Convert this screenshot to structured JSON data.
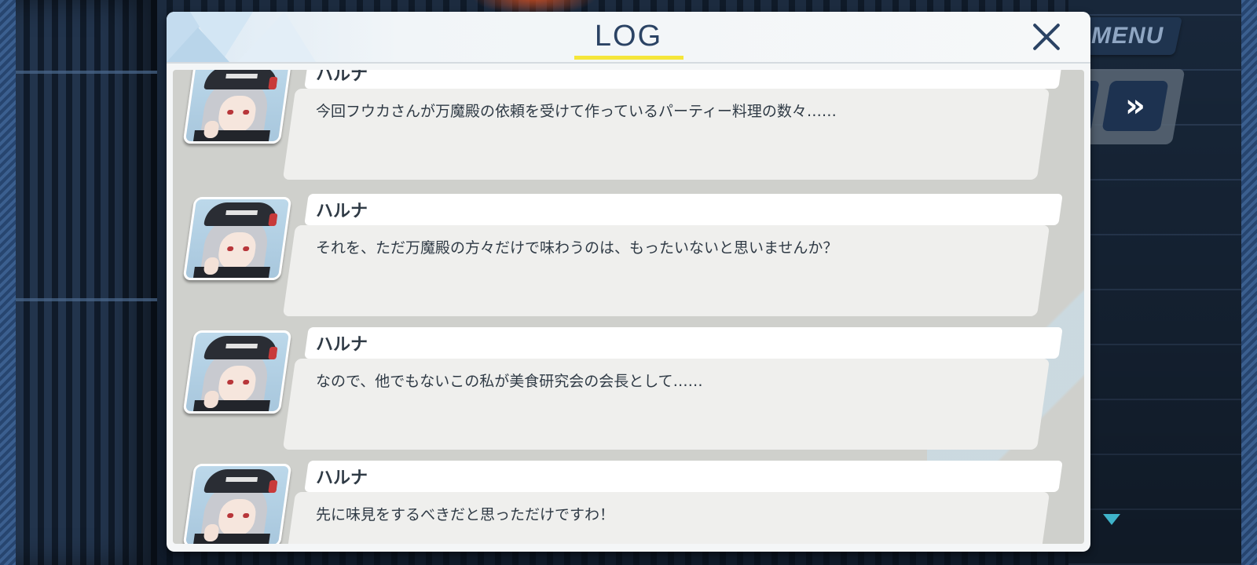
{
  "header": {
    "title": "LOG"
  },
  "controls": {
    "menu_label": "MENU",
    "skip_label": "»"
  },
  "colors": {
    "title": "#2b4364",
    "underline": "#f5e63a",
    "text": "#2f3a45",
    "accent_arrow": "#3fb3c9"
  },
  "icons": {
    "close": "close-icon",
    "skip": "fast-forward-icon",
    "next": "next-triangle-icon"
  },
  "log": {
    "entries": [
      {
        "speaker": "ハルナ",
        "text": "今回フウカさんが万魔殿の依頼を受けて作っているパーティー料理の数々……"
      },
      {
        "speaker": "ハルナ",
        "text": "それを、ただ万魔殿の方々だけで味わうのは、もったいないと思いませんか？"
      },
      {
        "speaker": "ハルナ",
        "text": "なので、他でもないこの私が美食研究会の会長として……"
      },
      {
        "speaker": "ハルナ",
        "text": "先に味見をするべきだと思っただけですわ！"
      }
    ]
  }
}
